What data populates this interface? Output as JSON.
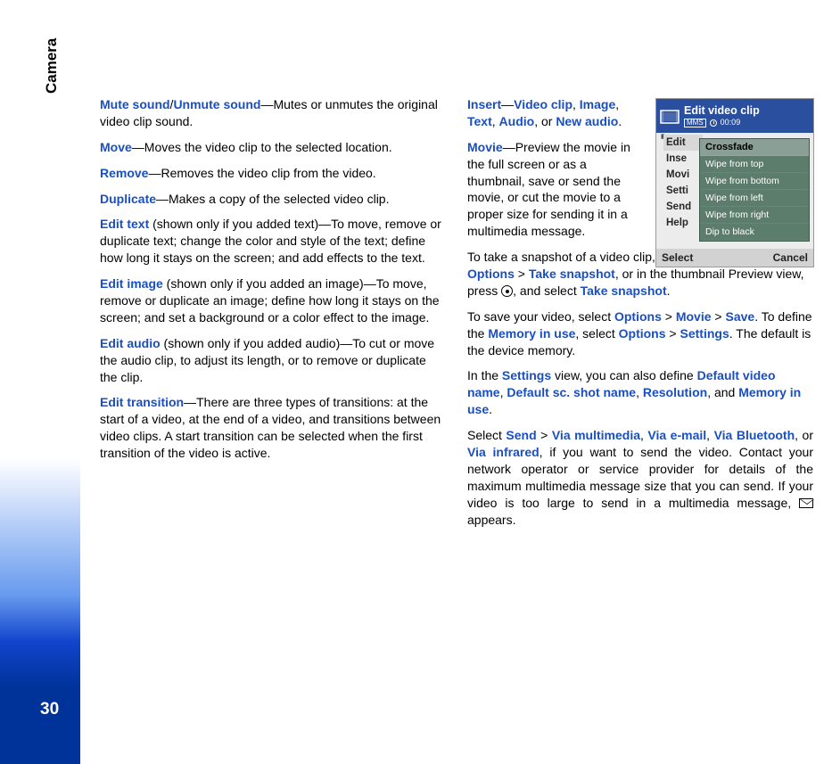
{
  "sidebar": {
    "section": "Camera",
    "page_number": "30"
  },
  "left": {
    "p1a": "Mute sound",
    "p1slash": "/",
    "p1b": "Unmute sound",
    "p1rest": "—Mutes or unmutes the original video clip sound.",
    "p2a": "Move",
    "p2rest": "—Moves the video clip to the selected location.",
    "p3a": "Remove",
    "p3rest": "—Removes the video clip from the video.",
    "p4a": "Duplicate",
    "p4rest": "—Makes a copy of the selected video clip.",
    "p5a": "Edit text",
    "p5rest": " (shown only if you added text)—To move, remove or duplicate text; change the color and style of the text; define how long it stays on the screen; and add effects to the text.",
    "p6a": "Edit image",
    "p6rest": " (shown only if you added an image)—To move, remove or duplicate an image; define how long it stays on the screen; and set a background or a color effect to the image.",
    "p7a": "Edit audio",
    "p7rest": " (shown only if you added audio)—To cut or move the audio clip, to adjust its length, or to remove or duplicate the clip.",
    "p8a": "Edit transition",
    "p8rest": "—There are three types of transitions: at the start of a video, at the end of a video, and transitions between video clips. A start transition can be selected when the first transition of the video is active."
  },
  "right": {
    "r1a": "Insert",
    "r1dash": "—",
    "r1b": "Video clip",
    "r1c1": ", ",
    "r1c": "Image",
    "r1c2": ", ",
    "r1d": "Text",
    "r1c3": ", ",
    "r1e": "Audio",
    "r1c4": ", or ",
    "r1f": "New audio",
    "r1end": ".",
    "r2a": "Movie",
    "r2rest": "—Preview the movie in the full screen or as a thumbnail, save or send the movie, or cut the movie to a proper size for sending it in a multimedia message.",
    "r3_pre": "To take a snapshot of a video clip, in the Cut video view, select ",
    "r3a": "Options",
    "r3gt1": " > ",
    "r3b": "Take snapshot",
    "r3mid": ", or in the thumbnail Preview view, press ",
    "r3mid2": ", and select ",
    "r3c": "Take snapshot",
    "r3end": ".",
    "r4_pre": "To save your video, select ",
    "r4a": "Options",
    "r4gt1": " > ",
    "r4b": "Movie",
    "r4gt2": " > ",
    "r4c": "Save",
    "r4mid": ". To define the ",
    "r4d": "Memory in use",
    "r4mid2": ", select ",
    "r4e": "Options",
    "r4gt3": " > ",
    "r4f": "Settings",
    "r4end": ". The default is the device memory.",
    "r5_pre": "In the ",
    "r5a": "Settings",
    "r5mid": " view, you can also define ",
    "r5b": "Default video name",
    "r5c1": ", ",
    "r5c": "Default sc. shot name",
    "r5c2": ", ",
    "r5d": "Resolution",
    "r5c3": ", and ",
    "r5e": "Memory in use",
    "r5end": ".",
    "r6_pre": "Select ",
    "r6a": "Send",
    "r6gt": " > ",
    "r6b": "Via multimedia",
    "r6c1": ", ",
    "r6c": "Via e-mail",
    "r6c2": ", ",
    "r6d": "Via Bluetooth",
    "r6c3": ", or ",
    "r6e": "Via infrared",
    "r6rest": ", if you want to send the video. Contact your network operator or service provider for details of the maximum multimedia message size that you can send. If your video is too large to send in a multimedia message, ",
    "r6end": " appears."
  },
  "phone": {
    "title": "Edit video clip",
    "mms": "MMS",
    "time": "00:09",
    "back_menu": [
      "Edit",
      "Inse",
      "Movi",
      "Setti",
      "Send",
      "Help"
    ],
    "popup": [
      "Crossfade",
      "Wipe from top",
      "Wipe from bottom",
      "Wipe from left",
      "Wipe from right",
      "Dip to black"
    ],
    "soft_left": "Select",
    "soft_right": "Cancel"
  }
}
